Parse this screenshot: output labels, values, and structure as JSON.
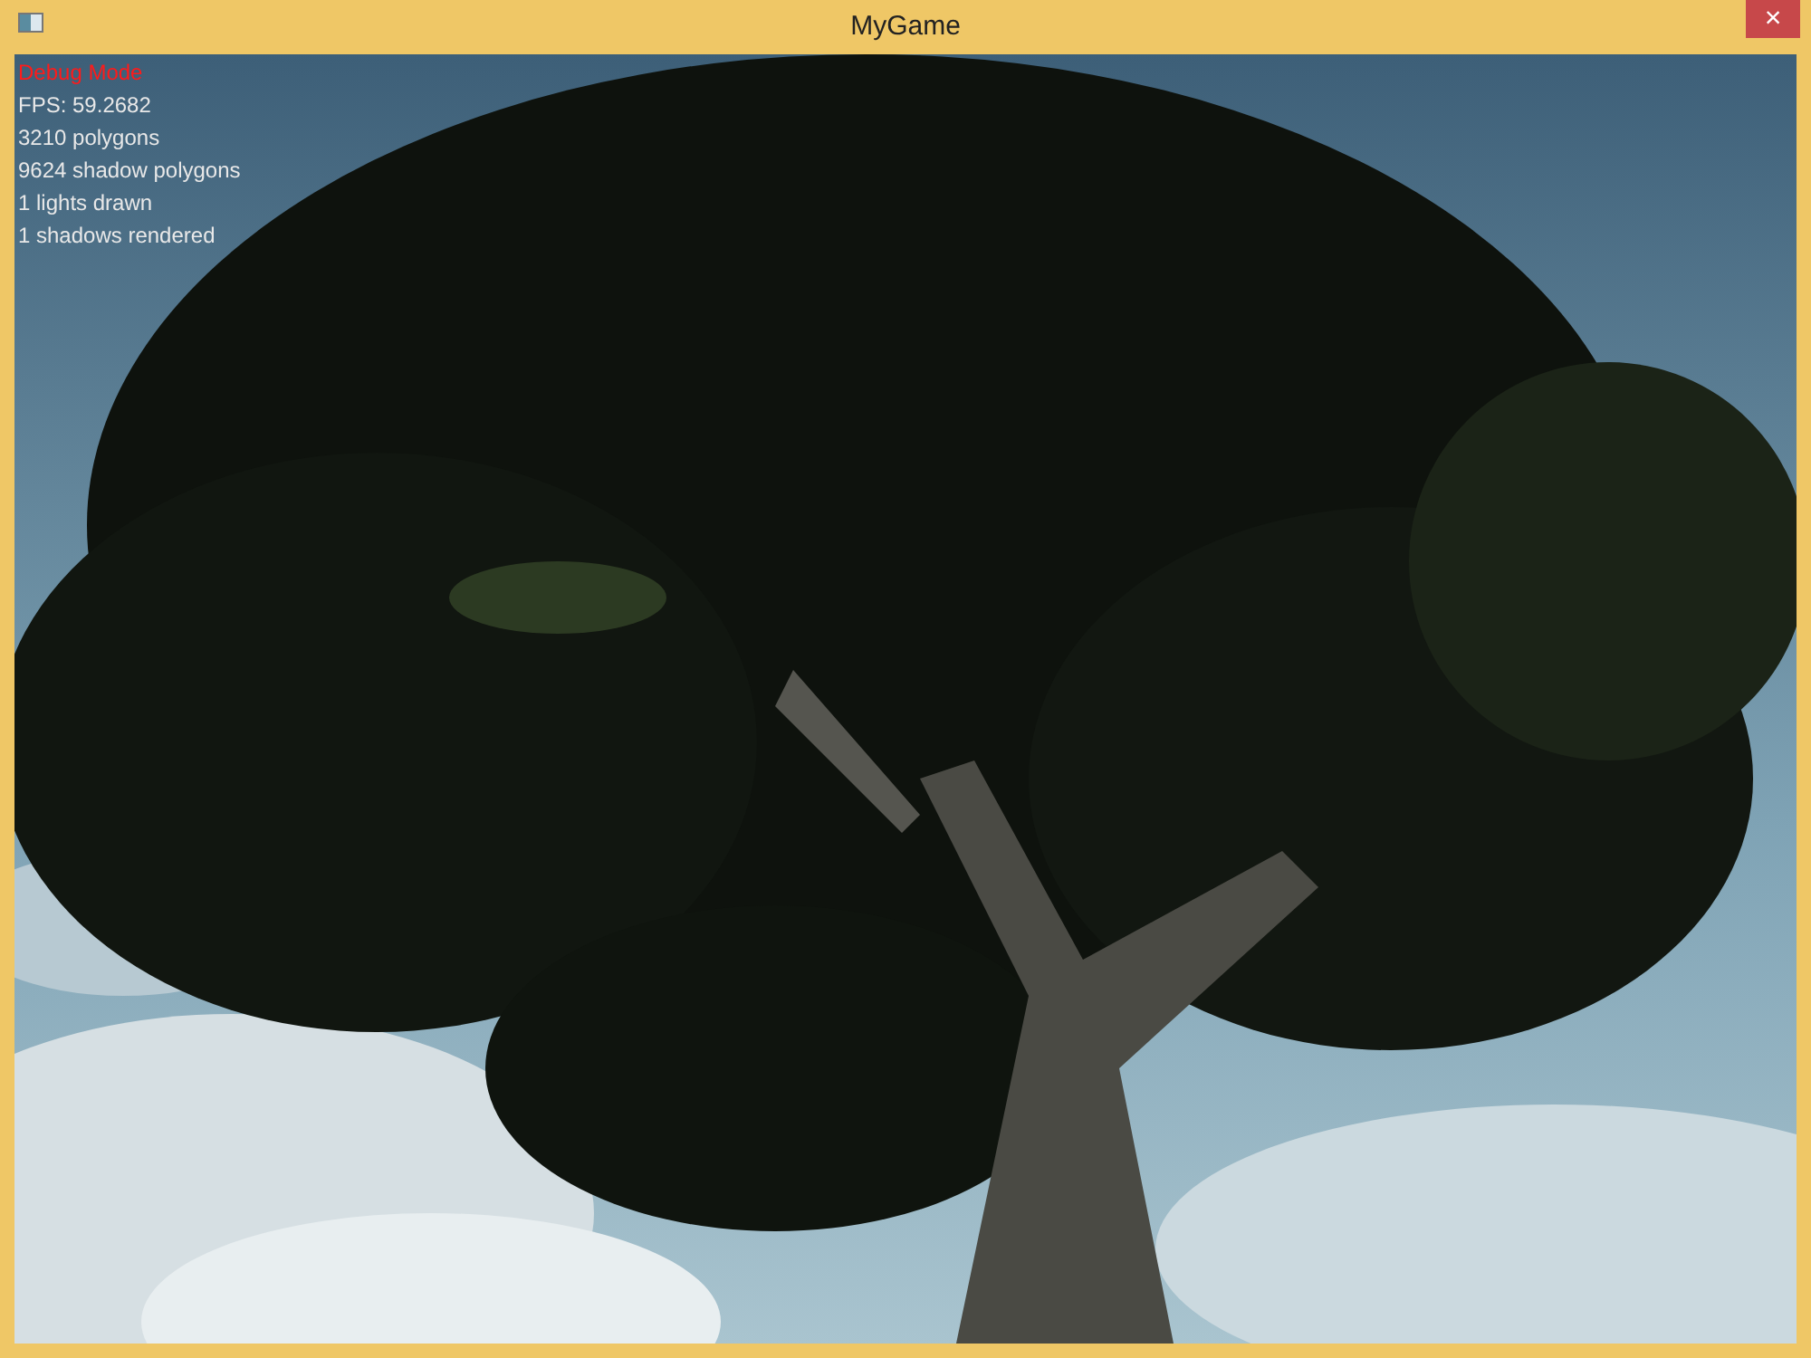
{
  "window": {
    "title": "MyGame",
    "close": "×"
  },
  "overlay": [
    {
      "kind": "heading",
      "text": "Debug Mode"
    },
    {
      "kind": "stat",
      "text": "FPS: 59.2682"
    },
    {
      "kind": "stat",
      "text": "3210 polygons"
    },
    {
      "kind": "stat",
      "text": "9624 shadow polygons"
    },
    {
      "kind": "stat",
      "text": "1 lights drawn"
    },
    {
      "kind": "stat",
      "text": "1 shadows rendered"
    }
  ]
}
